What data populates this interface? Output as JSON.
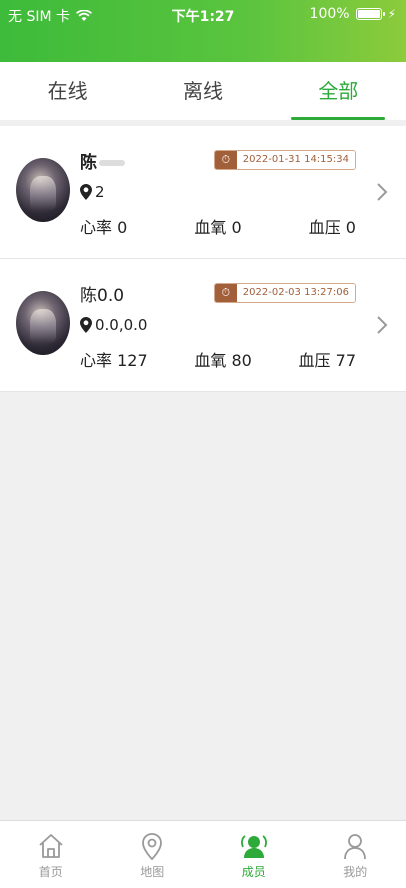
{
  "status_bar": {
    "carrier": "无 SIM 卡",
    "time": "下午1:27",
    "battery": "100%"
  },
  "tabs": [
    {
      "label": "在线"
    },
    {
      "label": "离线"
    },
    {
      "label": "全部"
    }
  ],
  "members": [
    {
      "name": "陈",
      "timestamp": "2022-01-31 14:15:34",
      "location": "2",
      "heart_rate_label": "心率",
      "heart_rate": "0",
      "blood_oxygen_label": "血氧",
      "blood_oxygen": "0",
      "blood_pressure_label": "血压",
      "blood_pressure": "0"
    },
    {
      "name": "陈0.0",
      "timestamp": "2022-02-03 13:27:06",
      "location": "0.0,0.0",
      "heart_rate_label": "心率",
      "heart_rate": "127",
      "blood_oxygen_label": "血氧",
      "blood_oxygen": "80",
      "blood_pressure_label": "血压",
      "blood_pressure": "77"
    }
  ],
  "bottom_nav": [
    {
      "label": "首页",
      "icon": "home-icon"
    },
    {
      "label": "地图",
      "icon": "map-pin-icon"
    },
    {
      "label": "成员",
      "icon": "members-icon"
    },
    {
      "label": "我的",
      "icon": "profile-icon"
    }
  ],
  "colors": {
    "accent": "#2daa3a",
    "badge": "#a15f3a"
  }
}
